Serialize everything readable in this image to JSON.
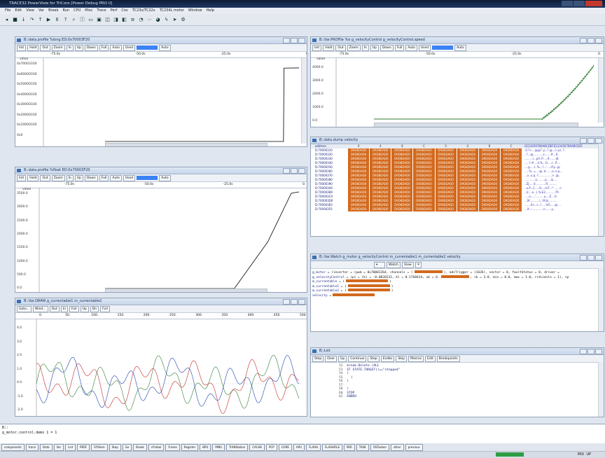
{
  "app": {
    "title": "TRACE32 PowerView for TriCore [Power Debug PRO II]",
    "menu": [
      "File",
      "Edit",
      "View",
      "Var",
      "Break",
      "Run",
      "CPU",
      "Misc",
      "Trace",
      "Perf",
      "Cov",
      "TC23x/TC22x",
      "TC234L motor",
      "Window",
      "Help"
    ]
  },
  "toolbar": {
    "icons": [
      "rewind-icon",
      "stop-icon",
      "step-icon",
      "step-over-icon",
      "up-icon",
      "go-icon",
      "break-icon",
      "help-icon",
      "search-icon",
      "info-icon",
      "window-icon",
      "chip-icon",
      "cpu-icon",
      "reg-icon",
      "var-icon",
      "list-icon",
      "chart-icon",
      "trace-icon",
      "perf-icon",
      "flash-icon",
      "run-icon",
      "settings-icon"
    ]
  },
  "colors": {
    "accent": "#3b82f6",
    "dump_cell": "#d2691e",
    "status_green": "#2f9e44",
    "ascii": "#3b36b5"
  },
  "win1": {
    "title": "B::data.profile %long ED:0x70003F20",
    "buttons": [
      "Init",
      "Hold",
      "Out",
      "Zoom",
      "In",
      "Up",
      "Down",
      "Full",
      "Auto",
      "Used",
      "Auto"
    ],
    "scale_labels": [
      "-75.0s",
      "-50.0s",
      "-25.0s",
      "0."
    ],
    "ylabel": "value",
    "y_ticks": [
      "0x70003330",
      "0x60000330",
      "0x50000330",
      "0x40000330",
      "0x30000330",
      "0x20000330",
      "0x10000330",
      "0x0"
    ]
  },
  "win2": {
    "title": "B::Var.PROFile %e g_velocityControl g_velocityControl.speed",
    "buttons": [
      "Init",
      "Hold",
      "Out",
      "Zoom",
      "In",
      "Up",
      "Down",
      "Full",
      "Auto",
      "Used",
      "Auto"
    ],
    "scale_labels": [
      "-75.0s",
      "-50.0s",
      "-25.0s",
      "0."
    ],
    "ylabel": "value",
    "y_ticks": [
      "4000.0",
      "3000.0",
      "2000.0",
      "1000.0",
      "0.0"
    ]
  },
  "win3": {
    "title": "B::data.profile %float ED:0x70003F20",
    "buttons": [
      "Init",
      "Hold",
      "Out",
      "Zoom",
      "In",
      "Up",
      "Down",
      "Full",
      "Auto",
      "Used",
      "Auto"
    ],
    "scale_labels": [
      "-75.0s",
      "-50.0s",
      "-25.0s",
      "0."
    ],
    "ylabel": "value",
    "y_ticks": [
      "3500.0",
      "3000.0",
      "2500.0",
      "2000.0",
      "1500.0",
      "1000.0",
      "500.0",
      "0.0"
    ]
  },
  "win4": {
    "title": "B::data.dump velocity",
    "header": [
      "address",
      "0",
      "4",
      "8",
      "C",
      "0",
      "4",
      "8",
      "C",
      "0123456789ABCDEF0123456789ABCDEF"
    ],
    "rows": [
      {
        "addr": "D:70000310",
        "ascii": ".0.?>...@@?..p..?.@...(~pr..?.."
      },
      {
        "addr": "D:70000320",
        "ascii": "..?...@...........z.......#...6.."
      },
      {
        "addr": "D:70000330",
        "ascii": "........:r...p9..P.....#.......|8"
      },
      {
        "addr": "D:70000340",
        "ascii": ".....?.#....3.%...O.....l...P...."
      },
      {
        "addr": "D:70000350",
        "ascii": "....g.....l..%...?...'....rFp..@."
      },
      {
        "addr": "D:70000360",
        "ascii": ".....%..=....@..d.......o..e.p..."
      },
      {
        "addr": "D:70000370",
        "ascii": "...x..u.q..?...............>..@.."
      },
      {
        "addr": "D:70000380",
        "ascii": "............a.........p.....&...."
      },
      {
        "addr": "D:70000390",
        "ascii": "..ZJ.....V............R.........."
      },
      {
        "addr": "D:700003A0",
        "ascii": "..u.P...C.....O....mT...*.......>"
      },
      {
        "addr": "D:700003B0",
        "ascii": "..U....e...(.%.E2...........?P..."
      },
      {
        "addr": "D:700003C0",
        "ascii": ".....o.....'.........u....Z....0."
      },
      {
        "addr": "D:700003D0",
        "ascii": "...M...........i...M.&.........."
      },
      {
        "addr": "D:700003E0",
        "ascii": ".......6>..s..?.....%5.....@...."
      },
      {
        "addr": "D:700003F0",
        "ascii": "...X..:.............n.......y..."
      }
    ],
    "cell": "D9D8DAD0"
  },
  "win5": {
    "title": "B::Var.Watch g_motor g_velocityControl m_currentable1 m_currentable2 velocity",
    "buttons": [
      "Watch",
      "View"
    ],
    "lines": [
      {
        "name": "g_motor",
        "value": "= (inverter = (pwm = 0x70001264, channels = (",
        "tail": "), adcTrigger = (1626), vector = 0, faultStatus = 0, driver ="
      },
      {
        "name": "g_velocityControl",
        "value": "= (pi = (ki = -0.0026532, kl = 0.1768434, uk = 0.",
        "tail": ", ik = 3.8, min = 0.0, max = 1.0, rstLimits = 1), sp"
      },
      {
        "name": "m_currentable",
        "value": "= (",
        "tail": ")"
      },
      {
        "name": "m_currentable1",
        "value": "= (",
        "tail": ")"
      },
      {
        "name": "m_currentable2",
        "value": "= (",
        "tail": ")"
      },
      {
        "name": "velocity",
        "value": "=",
        "tail": ""
      }
    ]
  },
  "win6": {
    "title": "B::Var.DRAW g_currentable1 m_currentable2",
    "buttons": [
      "Goto...",
      "Wind...",
      "Out",
      "In",
      "Full",
      "Up",
      "Dn",
      "Full"
    ],
    "scale_labels": [
      "0.",
      "50.",
      "100.",
      "150.",
      "200.",
      "250.",
      "300.",
      "350.",
      "400.",
      "450.",
      "500."
    ],
    "y_ticks": [
      "4.0",
      "3.0",
      "2.0",
      "1.0",
      "0.0",
      "-1.0",
      "-2.0"
    ]
  },
  "win7": {
    "title": "B::List",
    "buttons": [
      "Step",
      "Over",
      "Up",
      "Continue",
      "Stop",
      "Endbs",
      "Skip",
      "Macros",
      "Edit",
      "Breakpoints"
    ],
    "lines": [
      {
        "ln": "52",
        "code": "break.Delete /ALL"
      },
      {
        "ln": "53",
        "code": "IF STATE.TARGET()==\"stopped\""
      },
      {
        "ln": "54",
        "code": "("
      },
      {
        "ln": "55",
        "code": "  )"
      },
      {
        "ln": "56",
        "code": ")"
      },
      {
        "ln": "57",
        "code": ""
      },
      {
        "ln": "58",
        "code": ")"
      },
      {
        "ln": "60",
        "code": "STOP"
      },
      {
        "ln": "62",
        "code": "ENDDO"
      }
    ]
  },
  "cmdline": {
    "prompt": "B::",
    "history": "g_motor.control.demo 1 = 1"
  },
  "softkeys": [
    "components",
    "trace",
    "Data",
    "Var",
    "List",
    "PERF",
    "SYStem",
    "Step",
    "Go",
    "Break",
    "sYmbol",
    "Frame",
    "Register",
    "BPU",
    "MMU",
    "TrANSlation",
    "CACHE",
    "PCP",
    "CORE",
    "APU",
    "FLASH",
    "FLASHFILE",
    "PER",
    "TASK",
    "OSTaskon",
    "other",
    "previous"
  ],
  "status": {
    "mode": "MIX",
    "up": "UP"
  },
  "chart_data": [
    {
      "type": "line",
      "title": "B::data.profile %long ED:0x70003F20",
      "xlabel": "",
      "ylabel": "value",
      "x": [
        -75,
        -10,
        -6,
        -5.8,
        0
      ],
      "series": [
        {
          "values": [
            0,
            0,
            0,
            1625000000,
            1630000000
          ]
        }
      ]
    },
    {
      "type": "line",
      "title": "B::Var.PROFile %e g_velocityControl g_velocityControl.speed",
      "ylabel": "value",
      "x": [
        -75,
        -25,
        -20,
        -15,
        -10,
        -5,
        0
      ],
      "series": [
        {
          "values": [
            0,
            0,
            300,
            900,
            1700,
            2700,
            3550
          ]
        }
      ]
    },
    {
      "type": "line",
      "title": "B::data.profile %float ED:0x70003F20",
      "ylabel": "value",
      "x": [
        -75,
        -25,
        -12,
        -3,
        0
      ],
      "series": [
        {
          "values": [
            0,
            0,
            1700,
            3450,
            3500
          ]
        }
      ]
    },
    {
      "type": "line",
      "title": "B::Var.DRAW g_currentable1 m_currentable2",
      "xlabel": "",
      "ylabel": "",
      "ylim": [
        -2.5,
        4.5
      ],
      "series": [
        {
          "name": "",
          "color": "#2e7d32"
        },
        {
          "name": "",
          "color": "#c62828"
        },
        {
          "name": "",
          "color": "#1e40af"
        }
      ]
    }
  ]
}
